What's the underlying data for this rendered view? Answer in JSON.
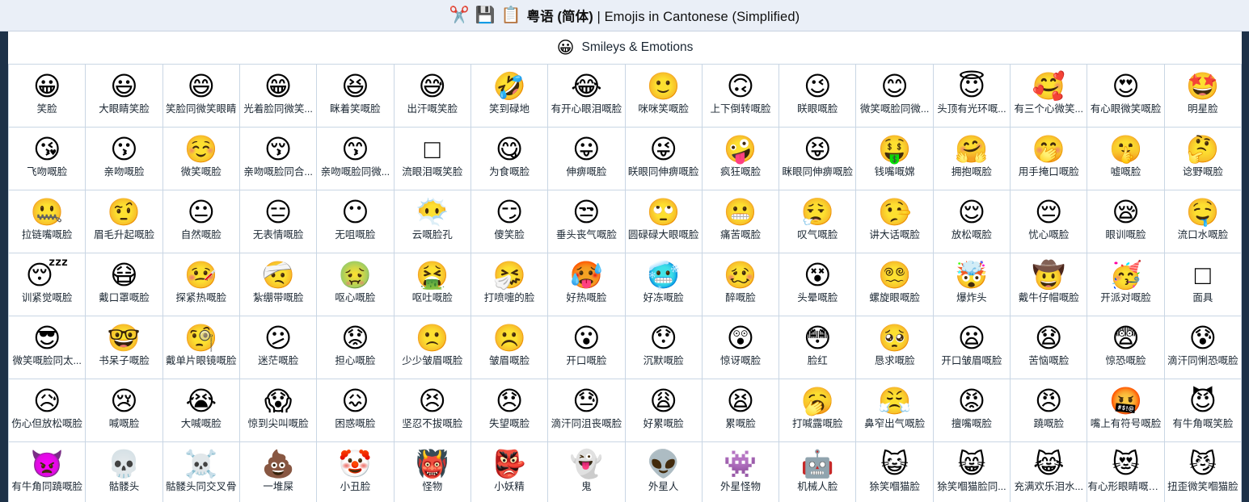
{
  "titlebar": {
    "icons": [
      "scissors-icon",
      "floppy-disk-icon",
      "clipboard-icon"
    ],
    "icon_glyphs": [
      "✂️",
      "💾",
      "📋"
    ],
    "title_cjk": "粤语 (简体)",
    "title_sep": " | ",
    "title_latin": "Emojis in Cantonese (Simplified)",
    "bg": "#eaeff7"
  },
  "section": {
    "icon": "grinning-face-icon",
    "icon_glyph": "😀",
    "label": "Smileys & Emotions"
  },
  "theme": {
    "rail": "#1d3148",
    "grid_line": "#c9d6e4",
    "text": "#1b2733",
    "page_bg": "#ffffff"
  },
  "grid": {
    "columns": 16,
    "cells": [
      {
        "glyph": "😀",
        "label": "笑脸"
      },
      {
        "glyph": "😃",
        "label": "大眼睛笑脸"
      },
      {
        "glyph": "😄",
        "label": "笑脸同微笑眼睛"
      },
      {
        "glyph": "😁",
        "label": "光着脸同微笑..."
      },
      {
        "glyph": "😆",
        "label": "眯着笑嘅脸"
      },
      {
        "glyph": "😅",
        "label": "出汗嘅笑脸"
      },
      {
        "glyph": "🤣",
        "label": "笑到碌地"
      },
      {
        "glyph": "😂",
        "label": "有开心眼泪嘅脸"
      },
      {
        "glyph": "🙂",
        "label": "咪咪笑嘅脸"
      },
      {
        "glyph": "🙃",
        "label": "上下倒转嘅脸"
      },
      {
        "glyph": "😉",
        "label": "眹眼嘅脸"
      },
      {
        "glyph": "😊",
        "label": "微笑嘅脸同微..."
      },
      {
        "glyph": "😇",
        "label": "头顶有光环嘅..."
      },
      {
        "glyph": "🥰",
        "label": "有三个心微笑..."
      },
      {
        "glyph": "😍",
        "label": "有心眼微笑嘅脸"
      },
      {
        "glyph": "🤩",
        "label": "明星脸"
      },
      {
        "glyph": "😘",
        "label": "飞吻嘅脸"
      },
      {
        "glyph": "😗",
        "label": "亲吻嘅脸"
      },
      {
        "glyph": "☺️",
        "label": "微笑嘅脸"
      },
      {
        "glyph": "😚",
        "label": "亲吻嘅脸同合..."
      },
      {
        "glyph": "😙",
        "label": "亲吻嘅脸同微..."
      },
      {
        "glyph": "□",
        "label": "流眼泪嘅笑脸"
      },
      {
        "glyph": "😋",
        "label": "为食嘅脸"
      },
      {
        "glyph": "😛",
        "label": "伸痹嘅脸"
      },
      {
        "glyph": "😜",
        "label": "眹眼同伸痹嘅脸"
      },
      {
        "glyph": "🤪",
        "label": "疯狂嘅脸"
      },
      {
        "glyph": "😝",
        "label": "眯眼同伸痹嘅脸"
      },
      {
        "glyph": "🤑",
        "label": "钱嘴嘅嫦"
      },
      {
        "glyph": "🤗",
        "label": "拥抱嘅脸"
      },
      {
        "glyph": "🤭",
        "label": "用手掩口嘅脸"
      },
      {
        "glyph": "🤫",
        "label": "嘘嘅脸"
      },
      {
        "glyph": "🤔",
        "label": "谂野嘅脸"
      },
      {
        "glyph": "🤐",
        "label": "拉链嘴嘅脸"
      },
      {
        "glyph": "🤨",
        "label": "眉毛升起嘅脸"
      },
      {
        "glyph": "😐",
        "label": "自然嘅脸"
      },
      {
        "glyph": "😑",
        "label": "无表情嘅脸"
      },
      {
        "glyph": "😶",
        "label": "无咀嘅脸"
      },
      {
        "glyph": "😶‍🌫️",
        "label": "云嘅脸孔"
      },
      {
        "glyph": "😏",
        "label": "傻笑脸"
      },
      {
        "glyph": "😒",
        "label": "垂头丧气嘅脸"
      },
      {
        "glyph": "🙄",
        "label": "圆碌碌大眼嘅脸"
      },
      {
        "glyph": "😬",
        "label": "痛苦嘅脸"
      },
      {
        "glyph": "😮‍💨",
        "label": "叹气嘅脸"
      },
      {
        "glyph": "🤥",
        "label": "讲大话嘅脸"
      },
      {
        "glyph": "😌",
        "label": "放松嘅脸"
      },
      {
        "glyph": "😔",
        "label": "忧心嘅脸"
      },
      {
        "glyph": "😪",
        "label": "眼训嘅脸"
      },
      {
        "glyph": "🤤",
        "label": "流口水嘅脸"
      },
      {
        "glyph": "😴",
        "label": "训紧觉嘅脸"
      },
      {
        "glyph": "😷",
        "label": "戴口罩嘅脸"
      },
      {
        "glyph": "🤒",
        "label": "探紧热嘅脸"
      },
      {
        "glyph": "🤕",
        "label": "紮绷带嘅脸"
      },
      {
        "glyph": "🤢",
        "label": "呕心嘅脸"
      },
      {
        "glyph": "🤮",
        "label": "呕吐嘅脸"
      },
      {
        "glyph": "🤧",
        "label": "打喷嚏的脸"
      },
      {
        "glyph": "🥵",
        "label": "好热嘅脸"
      },
      {
        "glyph": "🥶",
        "label": "好冻嘅脸"
      },
      {
        "glyph": "🥴",
        "label": "醉嘅脸"
      },
      {
        "glyph": "😵",
        "label": "头晕嘅脸"
      },
      {
        "glyph": "😵‍💫",
        "label": "螺旋眼嘅脸"
      },
      {
        "glyph": "🤯",
        "label": "爆炸头"
      },
      {
        "glyph": "🤠",
        "label": "戴牛仔帽嘅脸"
      },
      {
        "glyph": "🥳",
        "label": "开派对嘅脸"
      },
      {
        "glyph": "□",
        "label": "面具"
      },
      {
        "glyph": "😎",
        "label": "微笑嘅脸同太..."
      },
      {
        "glyph": "🤓",
        "label": "书呆子嘅脸"
      },
      {
        "glyph": "🧐",
        "label": "戴单片眼镜嘅脸"
      },
      {
        "glyph": "😕",
        "label": "迷茫嘅脸"
      },
      {
        "glyph": "😟",
        "label": "担心嘅脸"
      },
      {
        "glyph": "🙁",
        "label": "少少皱眉嘅脸"
      },
      {
        "glyph": "☹️",
        "label": "皱眉嘅脸"
      },
      {
        "glyph": "😮",
        "label": "开口嘅脸"
      },
      {
        "glyph": "😯",
        "label": "沉默嘅脸"
      },
      {
        "glyph": "😲",
        "label": "惊讶嘅脸"
      },
      {
        "glyph": "😳",
        "label": "脸红"
      },
      {
        "glyph": "🥺",
        "label": "恳求嘅脸"
      },
      {
        "glyph": "😦",
        "label": "开口皱眉嘅脸"
      },
      {
        "glyph": "😧",
        "label": "苦恼嘅脸"
      },
      {
        "glyph": "😨",
        "label": "惊恐嘅脸"
      },
      {
        "glyph": "😰",
        "label": "滴汗同悧恐嘅脸"
      },
      {
        "glyph": "😥",
        "label": "伤心但放松嘅脸"
      },
      {
        "glyph": "😢",
        "label": "喊嘅脸"
      },
      {
        "glyph": "😭",
        "label": "大喊嘅脸"
      },
      {
        "glyph": "😱",
        "label": "惊到尖叫嘅脸"
      },
      {
        "glyph": "😖",
        "label": "困惑嘅脸"
      },
      {
        "glyph": "😣",
        "label": "坚忍不拔嘅脸"
      },
      {
        "glyph": "😞",
        "label": "失望嘅脸"
      },
      {
        "glyph": "😓",
        "label": "滴汗同沮丧嘅脸"
      },
      {
        "glyph": "😩",
        "label": "好累嘅脸"
      },
      {
        "glyph": "😫",
        "label": "累嘅脸"
      },
      {
        "glyph": "🥱",
        "label": "打喊露嘅脸"
      },
      {
        "glyph": "😤",
        "label": "鼻窄出气嘅脸"
      },
      {
        "glyph": "😡",
        "label": "擅嘴嘅脸"
      },
      {
        "glyph": "😠",
        "label": "蹺嘅脸"
      },
      {
        "glyph": "🤬",
        "label": "嘴上有符号嘅脸"
      },
      {
        "glyph": "😈",
        "label": "有牛角嘅笑脸"
      },
      {
        "glyph": "👿",
        "label": "有牛角同蹺嘅脸"
      },
      {
        "glyph": "💀",
        "label": "骷髅头"
      },
      {
        "glyph": "☠️",
        "label": "骷髅头同交叉骨"
      },
      {
        "glyph": "💩",
        "label": "一堆屎"
      },
      {
        "glyph": "🤡",
        "label": "小丑脸"
      },
      {
        "glyph": "👹",
        "label": "怪物"
      },
      {
        "glyph": "👺",
        "label": "小妖精"
      },
      {
        "glyph": "👻",
        "label": "鬼"
      },
      {
        "glyph": "👽",
        "label": "外星人"
      },
      {
        "glyph": "👾",
        "label": "外星怪物"
      },
      {
        "glyph": "🤖",
        "label": "机械人脸"
      },
      {
        "glyph": "😺",
        "label": "狳笑嗰猫脸"
      },
      {
        "glyph": "😸",
        "label": "狳笑嗰猫脸同..."
      },
      {
        "glyph": "😹",
        "label": "充满欢乐泪水..."
      },
      {
        "glyph": "😻",
        "label": "有心形眼睛嘅微..."
      },
      {
        "glyph": "😼",
        "label": "扭歪微笑嗰猫脸"
      }
    ]
  }
}
